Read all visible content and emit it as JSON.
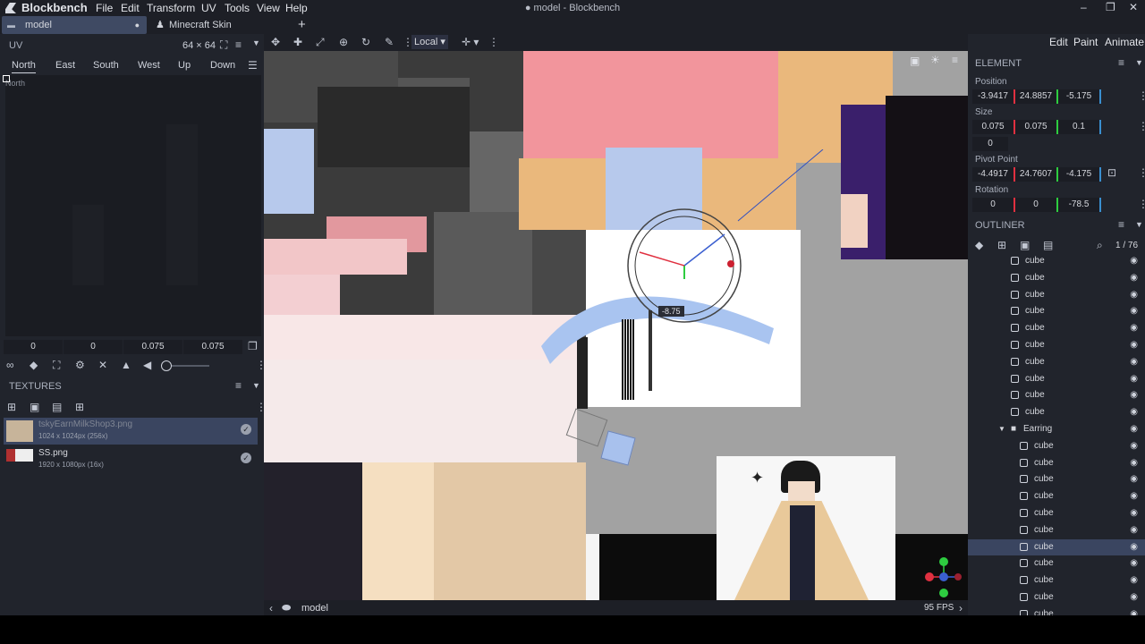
{
  "app": {
    "name": "Blockbench",
    "window_title": "● model - Blockbench"
  },
  "menu": [
    "File",
    "Edit",
    "Transform",
    "UV",
    "Tools",
    "View",
    "Help"
  ],
  "tabs": [
    {
      "label": "model"
    },
    {
      "label": "Minecraft Skin"
    }
  ],
  "uv_panel": {
    "title": "UV",
    "resolution": "64 × 64",
    "faces": [
      "North",
      "East",
      "South",
      "West",
      "Up",
      "Down"
    ],
    "face_label": "North",
    "values": [
      "0",
      "0",
      "0.075",
      "0.075"
    ]
  },
  "textures": {
    "title": "TEXTURES",
    "items": [
      {
        "name": "tskyEarnMilkShop3.png",
        "info": "1024 x 1024px (256x)"
      },
      {
        "name": "SS.png",
        "info": "1920 x 1080px (16x)"
      }
    ]
  },
  "viewport": {
    "space_mode": "Local",
    "rotation_readout": "-8.75",
    "status_model": "model",
    "fps": "95 FPS"
  },
  "modes": [
    "Edit",
    "Paint",
    "Animate"
  ],
  "element": {
    "title": "ELEMENT",
    "position_label": "Position",
    "position": [
      "-3.9417",
      "24.8857",
      "-5.175"
    ],
    "size_label": "Size",
    "size": [
      "0.075",
      "0.075",
      "0.1"
    ],
    "inflate": "0",
    "pivot_label": "Pivot Point",
    "pivot": [
      "-4.4917",
      "24.7607",
      "-4.175"
    ],
    "rotation_label": "Rotation",
    "rotation": [
      "0",
      "0",
      "-78.5"
    ]
  },
  "outliner": {
    "title": "OUTLINER",
    "count": "1 / 76",
    "rows": [
      {
        "label": "cube",
        "type": "cube"
      },
      {
        "label": "cube",
        "type": "cube"
      },
      {
        "label": "cube",
        "type": "cube"
      },
      {
        "label": "cube",
        "type": "cube"
      },
      {
        "label": "cube",
        "type": "cube"
      },
      {
        "label": "cube",
        "type": "cube"
      },
      {
        "label": "cube",
        "type": "cube"
      },
      {
        "label": "cube",
        "type": "cube"
      },
      {
        "label": "cube",
        "type": "cube"
      },
      {
        "label": "cube",
        "type": "cube"
      },
      {
        "label": "Earring",
        "type": "group"
      },
      {
        "label": "cube",
        "type": "cube"
      },
      {
        "label": "cube",
        "type": "cube"
      },
      {
        "label": "cube",
        "type": "cube"
      },
      {
        "label": "cube",
        "type": "cube"
      },
      {
        "label": "cube",
        "type": "cube"
      },
      {
        "label": "cube",
        "type": "cube"
      },
      {
        "label": "cube",
        "type": "cube",
        "selected": true
      },
      {
        "label": "cube",
        "type": "cube"
      },
      {
        "label": "cube",
        "type": "cube"
      },
      {
        "label": "cube",
        "type": "cube"
      },
      {
        "label": "cube",
        "type": "cube"
      }
    ]
  },
  "colors": {
    "accent": "#3a4560",
    "panel": "#21242c",
    "dark": "#1d1f26"
  }
}
